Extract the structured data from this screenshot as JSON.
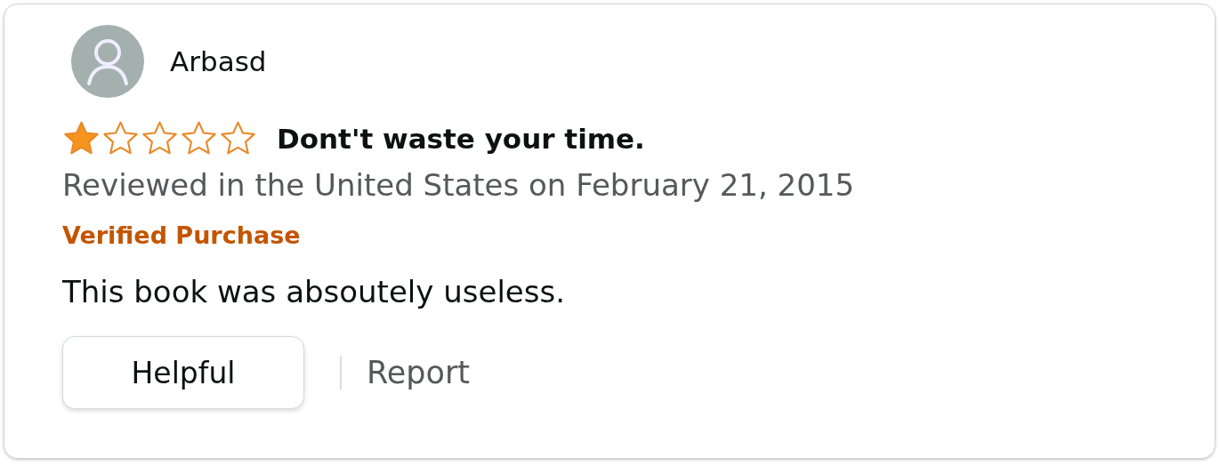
{
  "review": {
    "author": "Arbasd",
    "stars": 1,
    "title": "Dont't waste your time.",
    "date_line": "Reviewed in the United States on February 21, 2015",
    "badge": "Verified Purchase",
    "body": "This book was absoutely useless.",
    "buttons": [
      "Helpful",
      "Report"
    ]
  }
}
